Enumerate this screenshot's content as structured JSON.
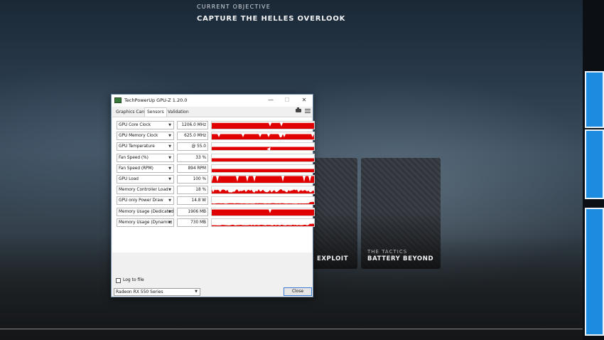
{
  "game": {
    "objective_caption": "CURRENT OBJECTIVE",
    "objective_title": "CAPTURE THE HELLES OVERLOOK",
    "cards": [
      {
        "caption": "",
        "title": "EXPLOIT"
      },
      {
        "caption": "THE TACTICS",
        "title": "BATTERY BEYOND"
      }
    ]
  },
  "gpuz": {
    "title": "TechPowerUp GPU-Z 1.20.0",
    "window_controls": [
      "—",
      "☐",
      "✕"
    ],
    "tabs": [
      "Graphics Card",
      "Sensors",
      "Validation"
    ],
    "active_tab": "Sensors",
    "sensors": [
      {
        "name": "GPU Core Clock",
        "value": "1206.0 MHz",
        "level": 0.82,
        "style": "solid"
      },
      {
        "name": "GPU Memory Clock",
        "value": "625.0 MHz",
        "level": 0.75,
        "style": "solid"
      },
      {
        "name": "GPU Temperature",
        "value": "@ 55.0",
        "level": 0.35,
        "style": "band"
      },
      {
        "name": "Fan Speed (%)",
        "value": "33 %",
        "level": 0.33,
        "style": "band"
      },
      {
        "name": "Fan Speed (RPM)",
        "value": "894 RPM",
        "level": 0.3,
        "style": "band"
      },
      {
        "name": "GPU Load",
        "value": "100 %",
        "level": 0.95,
        "style": "spiky"
      },
      {
        "name": "Memory Controller Load",
        "value": "18 %",
        "level": 0.4,
        "style": "noisy"
      },
      {
        "name": "GPU only Power Draw",
        "value": "14.8 W",
        "level": 0.1,
        "style": "low"
      },
      {
        "name": "Memory Usage (Dedicated)",
        "value": "1906 MB",
        "level": 0.85,
        "style": "solid"
      },
      {
        "name": "Memory Usage (Dynamic)",
        "value": "730 MB",
        "level": 0.15,
        "style": "low"
      }
    ],
    "log_label": "Log to file",
    "gpu_name": "Radeon RX 550 Series",
    "close_label": "Close",
    "graph_color": "#e00000"
  }
}
